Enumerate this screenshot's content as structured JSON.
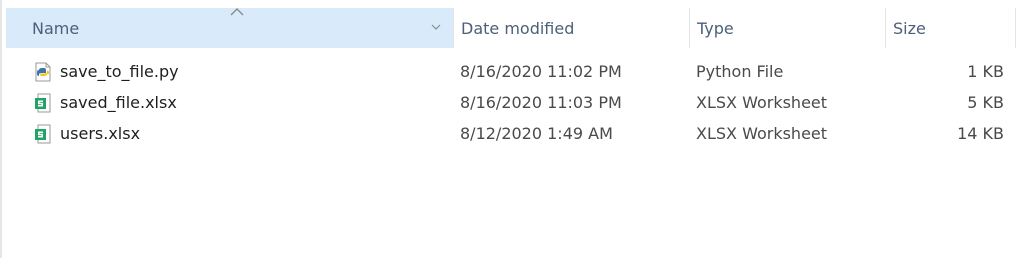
{
  "header": {
    "columns": [
      {
        "label": "Name"
      },
      {
        "label": "Date modified"
      },
      {
        "label": "Type"
      },
      {
        "label": "Size"
      }
    ],
    "sorted_column": "Name",
    "sort_direction": "ascending"
  },
  "files": [
    {
      "name": "save_to_file.py",
      "date_modified": "8/16/2020 11:02 PM",
      "type": "Python File",
      "size": "1 KB",
      "icon": "python-file-icon"
    },
    {
      "name": "saved_file.xlsx",
      "date_modified": "8/16/2020 11:03 PM",
      "type": "XLSX Worksheet",
      "size": "5 KB",
      "icon": "xlsx-file-icon"
    },
    {
      "name": "users.xlsx",
      "date_modified": "8/12/2020 1:49 AM",
      "type": "XLSX Worksheet",
      "size": "14 KB",
      "icon": "xlsx-file-icon"
    }
  ],
  "colors": {
    "header_selected_bg": "#d9ebfa",
    "header_text": "#4c607a",
    "xlsx_green": "#21a366",
    "python_blue": "#3a75b0",
    "python_yellow": "#f5c518"
  }
}
